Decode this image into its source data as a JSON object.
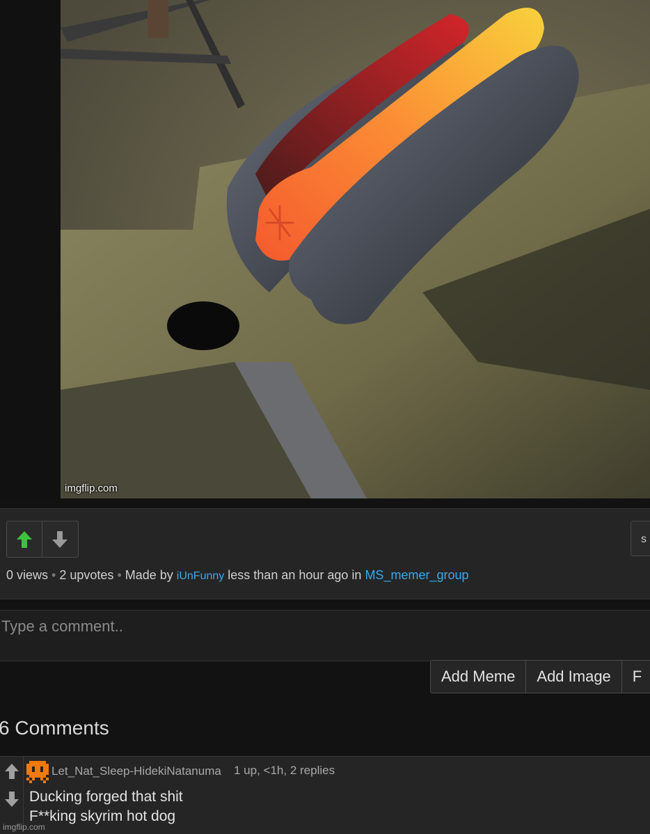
{
  "meme": {
    "watermark": "imgflip.com"
  },
  "post": {
    "stats": {
      "views": "0 views",
      "upvotes": "2 upvotes",
      "made_by": "Made by",
      "author": "iUnFunny",
      "time": "less than an hour ago in",
      "group": "MS_memer_group"
    },
    "share_label": "s"
  },
  "comment_form": {
    "placeholder": "Type a comment..",
    "add_meme": "Add Meme",
    "add_image": "Add Image",
    "third_button": "F"
  },
  "comments": {
    "heading": "6 Comments",
    "items": [
      {
        "user": "Let_Nat_Sleep-HidekiNatanuma",
        "meta": "1 up, <1h, 2 replies",
        "line1": "Ducking forged that shit",
        "line2": "F**king skyrim hot dog"
      }
    ]
  },
  "footer": {
    "watermark": "imgflip.com"
  },
  "colors": {
    "upvote_active": "#3ec13e",
    "link": "#3aa8ea",
    "avatar_orange": "#f07a10"
  },
  "icons": {
    "upvote": "arrow-up-icon",
    "downvote": "arrow-down-icon",
    "avatar": "pixel-skull-avatar-icon"
  }
}
